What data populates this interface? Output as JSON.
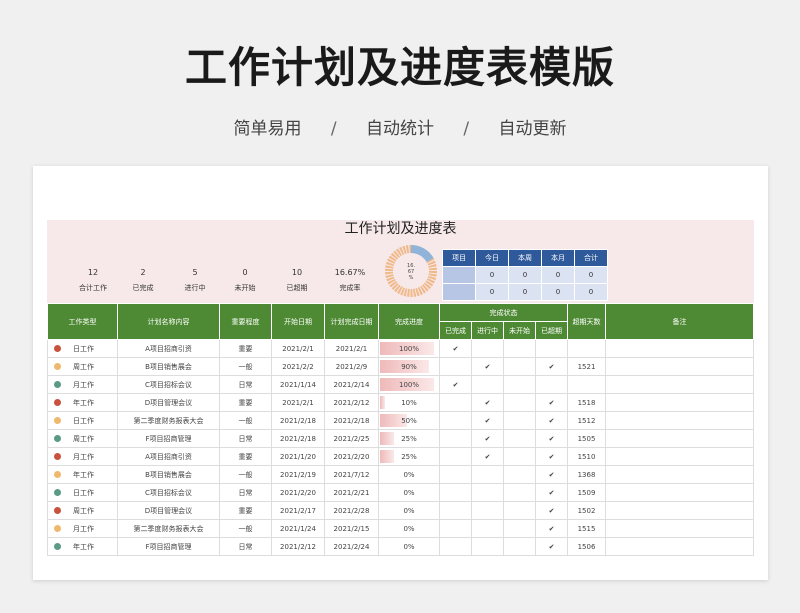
{
  "hero": {
    "title": "工作计划及进度表模版",
    "tags": [
      "简单易用",
      "自动统计",
      "自动更新"
    ],
    "separator": "/"
  },
  "sheet": {
    "title": "工作计划及进度表",
    "stats": [
      {
        "value": "12",
        "label": "合计工作"
      },
      {
        "value": "2",
        "label": "已完成"
      },
      {
        "value": "5",
        "label": "进行中"
      },
      {
        "value": "0",
        "label": "未开始"
      },
      {
        "value": "10",
        "label": "已超期"
      },
      {
        "value": "16.67%",
        "label": "完成率"
      }
    ],
    "donut": {
      "text_line1": "16.",
      "text_line2": "67",
      "text_line3": "%",
      "completed_fraction": 0.1667,
      "color_done": "#8fb3d9",
      "color_rest": "#f0b98a"
    },
    "mini_table": {
      "headers": [
        "项目",
        "今日",
        "本周",
        "本月",
        "合计"
      ],
      "rows": [
        {
          "label": "",
          "values": [
            "0",
            "0",
            "0",
            "0"
          ]
        },
        {
          "label": "",
          "values": [
            "0",
            "0",
            "0",
            "0"
          ]
        }
      ]
    },
    "columns": {
      "type": "工作类型",
      "name": "计划名称内容",
      "importance": "重要程度",
      "start": "开始日期",
      "plan_end": "计划完成日期",
      "progress": "完成进度",
      "status_group": "完成状态",
      "done": "已完成",
      "doing": "进行中",
      "not_started": "未开始",
      "overdue": "已超期",
      "overdue_days": "超期天数",
      "remark": "备注"
    },
    "check": "✔",
    "rows": [
      {
        "color": "#c9523f",
        "type": "日工作",
        "name": "A项目招商引资",
        "imp": "重要",
        "imp_class": "imp-zy",
        "start": "2021/2/1",
        "end": "2021/2/1",
        "progress": "100%",
        "pv": 100,
        "done": true,
        "doing": false,
        "ns": false,
        "over": false,
        "days": ""
      },
      {
        "color": "#f0b86c",
        "type": "周工作",
        "name": "B项目销售展会",
        "imp": "一般",
        "imp_class": "imp-yb",
        "start": "2021/2/2",
        "end": "2021/2/9",
        "progress": "90%",
        "pv": 90,
        "done": false,
        "doing": true,
        "ns": false,
        "over": true,
        "days": "1521"
      },
      {
        "color": "#5b9a84",
        "type": "月工作",
        "name": "C项目招标会议",
        "imp": "日常",
        "imp_class": "imp-rc",
        "start": "2021/1/14",
        "end": "2021/2/14",
        "progress": "100%",
        "pv": 100,
        "done": true,
        "doing": false,
        "ns": false,
        "over": false,
        "days": ""
      },
      {
        "color": "#c9523f",
        "type": "年工作",
        "name": "D项目管理会议",
        "imp": "重要",
        "imp_class": "imp-zy",
        "start": "2021/2/1",
        "end": "2021/2/12",
        "progress": "10%",
        "pv": 10,
        "done": false,
        "doing": true,
        "ns": false,
        "over": true,
        "days": "1518"
      },
      {
        "color": "#f0b86c",
        "type": "日工作",
        "name": "第二季度财务报表大会",
        "imp": "一般",
        "imp_class": "imp-yb",
        "start": "2021/2/18",
        "end": "2021/2/18",
        "progress": "50%",
        "pv": 50,
        "done": false,
        "doing": true,
        "ns": false,
        "over": true,
        "days": "1512"
      },
      {
        "color": "#5b9a84",
        "type": "周工作",
        "name": "F项目招商管理",
        "imp": "日常",
        "imp_class": "imp-rc",
        "start": "2021/2/18",
        "end": "2021/2/25",
        "progress": "25%",
        "pv": 25,
        "done": false,
        "doing": true,
        "ns": false,
        "over": true,
        "days": "1505"
      },
      {
        "color": "#c9523f",
        "type": "月工作",
        "name": "A项目招商引资",
        "imp": "重要",
        "imp_class": "imp-zy",
        "start": "2021/1/20",
        "end": "2021/2/20",
        "progress": "25%",
        "pv": 25,
        "done": false,
        "doing": true,
        "ns": false,
        "over": true,
        "days": "1510"
      },
      {
        "color": "#f0b86c",
        "type": "年工作",
        "name": "B项目销售展会",
        "imp": "一般",
        "imp_class": "imp-yb",
        "start": "2021/2/19",
        "end": "2021/7/12",
        "progress": "0%",
        "pv": 0,
        "done": false,
        "doing": false,
        "ns": false,
        "over": true,
        "days": "1368"
      },
      {
        "color": "#5b9a84",
        "type": "日工作",
        "name": "C项目招标会议",
        "imp": "日常",
        "imp_class": "imp-rc",
        "start": "2021/2/20",
        "end": "2021/2/21",
        "progress": "0%",
        "pv": 0,
        "done": false,
        "doing": false,
        "ns": false,
        "over": true,
        "days": "1509"
      },
      {
        "color": "#c9523f",
        "type": "周工作",
        "name": "D项目管理会议",
        "imp": "重要",
        "imp_class": "imp-zy",
        "start": "2021/2/17",
        "end": "2021/2/28",
        "progress": "0%",
        "pv": 0,
        "done": false,
        "doing": false,
        "ns": false,
        "over": true,
        "days": "1502"
      },
      {
        "color": "#f0b86c",
        "type": "月工作",
        "name": "第二季度财务报表大会",
        "imp": "一般",
        "imp_class": "imp-yb",
        "start": "2021/1/24",
        "end": "2021/2/15",
        "progress": "0%",
        "pv": 0,
        "done": false,
        "doing": false,
        "ns": false,
        "over": true,
        "days": "1515"
      },
      {
        "color": "#5b9a84",
        "type": "年工作",
        "name": "F项目招商管理",
        "imp": "日常",
        "imp_class": "imp-rc",
        "start": "2021/2/12",
        "end": "2021/2/24",
        "progress": "0%",
        "pv": 0,
        "done": false,
        "doing": false,
        "ns": false,
        "over": true,
        "days": "1506"
      }
    ]
  }
}
